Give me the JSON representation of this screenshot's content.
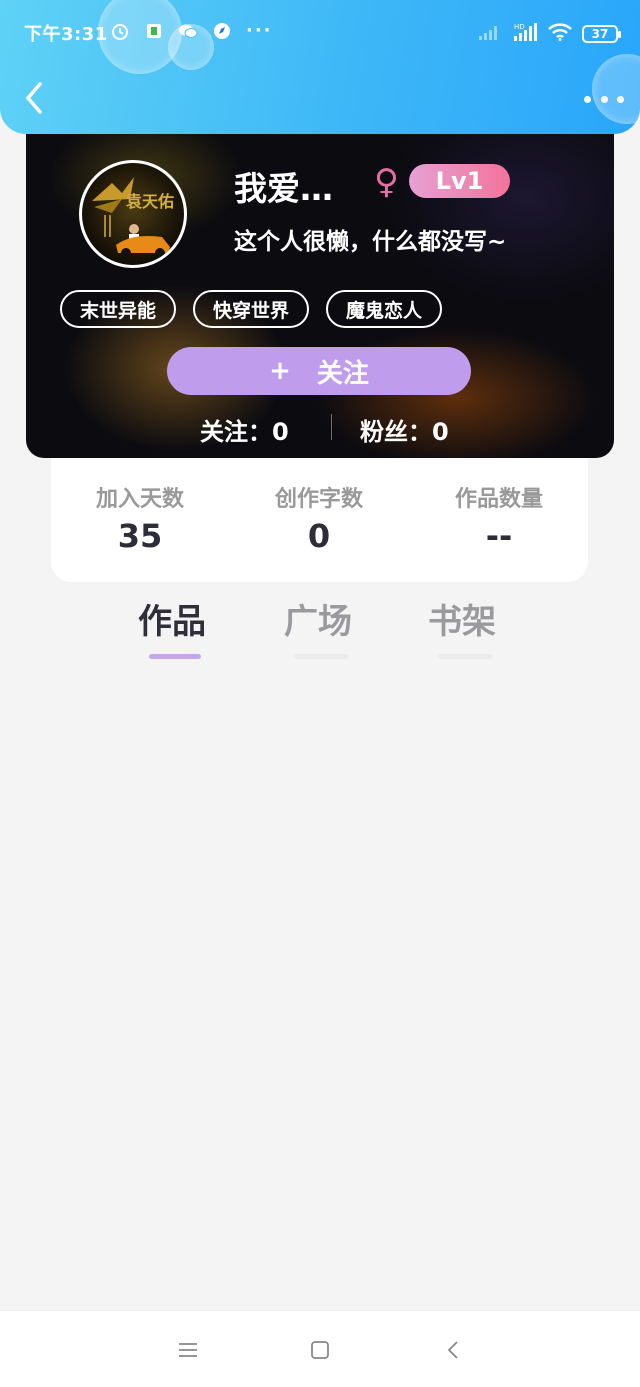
{
  "status_bar": {
    "time": "下午3:31",
    "more_dots": "···",
    "battery": "37"
  },
  "profile": {
    "username": "我爱…",
    "gender_symbol": "♀",
    "level": "Lv1",
    "bio": "这个人很懒，什么都没写~",
    "tags": [
      "末世异能",
      "快穿世界",
      "魔鬼恋人"
    ],
    "follow_plus": "+",
    "follow_label": "关注",
    "following_text": "关注：0",
    "fans_text": "粉丝：0"
  },
  "info": {
    "joined_label": "加入天数",
    "joined_value": "35",
    "words_label": "创作字数",
    "words_value": "0",
    "works_label": "作品数量",
    "works_value": "--"
  },
  "tabs": {
    "works": "作品",
    "square": "广场",
    "bookshelf": "书架"
  },
  "icons": {
    "back": "chevron-left-icon",
    "more": "more-horizontal-icon",
    "nav_menu": "menu-icon",
    "nav_home": "square-icon",
    "nav_back": "triangle-back-icon"
  }
}
